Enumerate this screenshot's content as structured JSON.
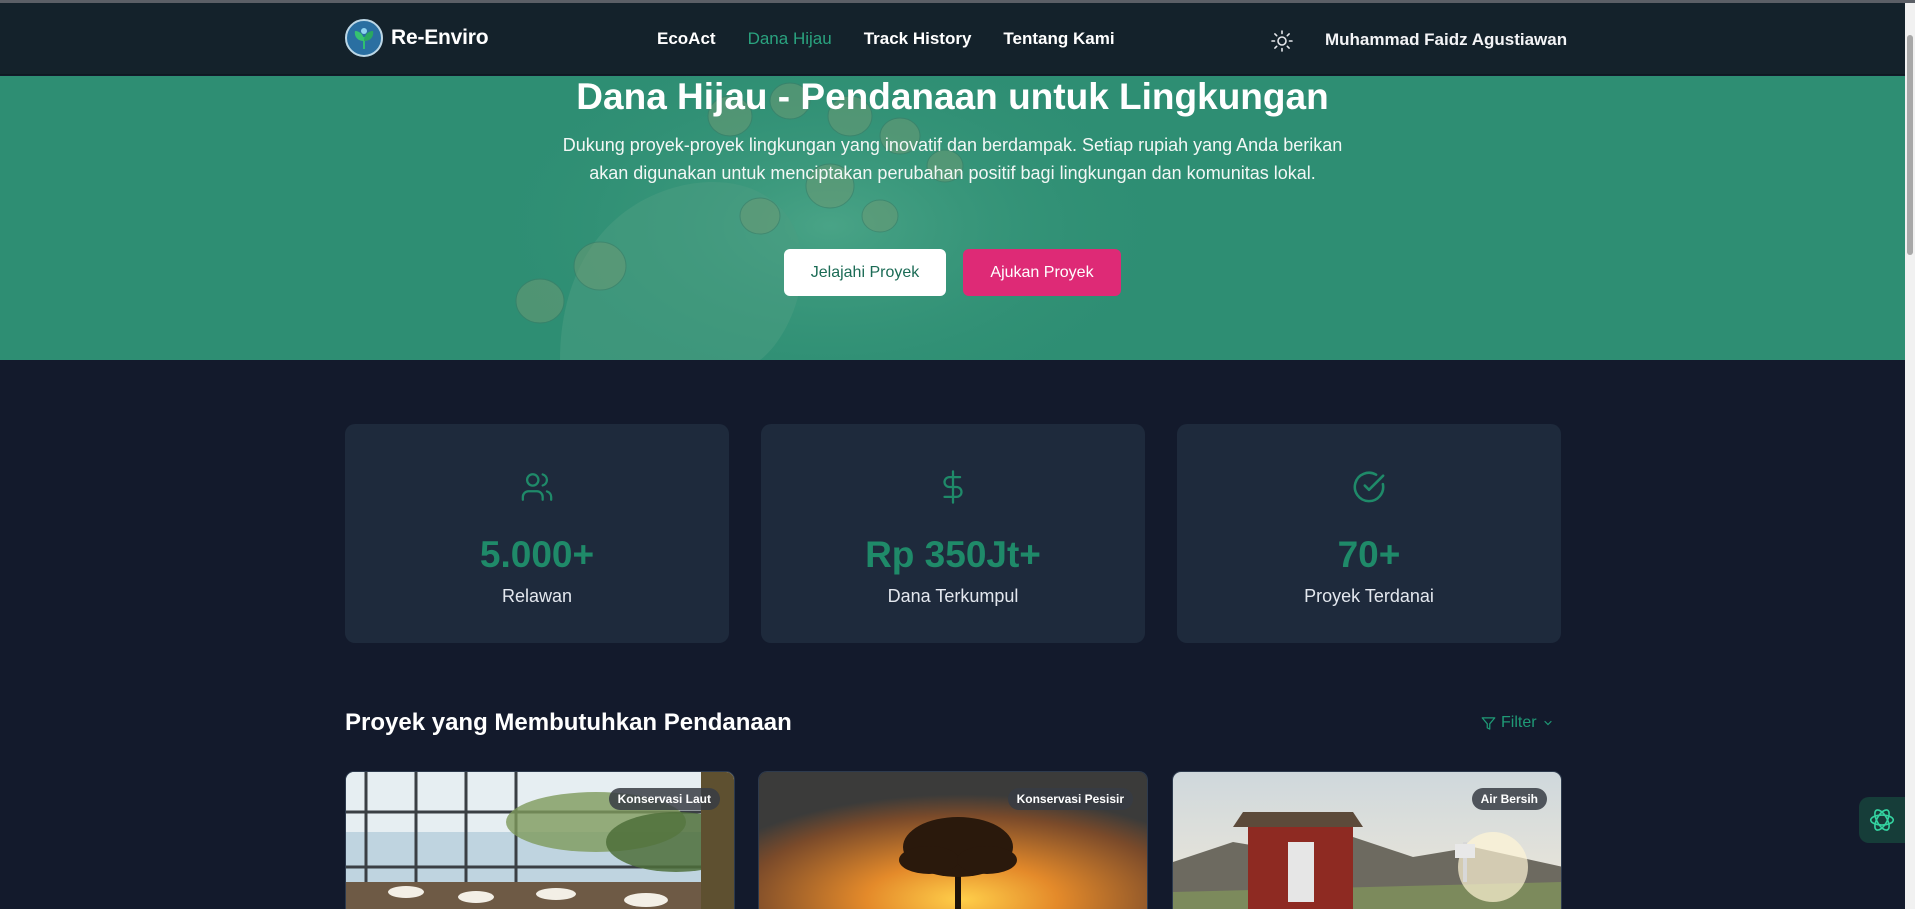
{
  "navbar": {
    "brand": "Re-Enviro",
    "links": [
      {
        "label": "EcoAct",
        "active": false
      },
      {
        "label": "Dana Hijau",
        "active": true
      },
      {
        "label": "Track History",
        "active": false
      },
      {
        "label": "Tentang Kami",
        "active": false
      }
    ],
    "theme_icon": "sun-icon",
    "user_name": "Muhammad Faidz Agustiawan"
  },
  "hero": {
    "title": "Dana Hijau - Pendanaan untuk Lingkungan",
    "description": "Dukung proyek-proyek lingkungan yang inovatif dan berdampak. Setiap rupiah yang Anda berikan akan digunakan untuk menciptakan perubahan positif bagi lingkungan dan komunitas lokal.",
    "primary_button": "Jelajahi Proyek",
    "secondary_button": "Ajukan Proyek"
  },
  "stats": [
    {
      "icon": "users-icon",
      "value": "5.000+",
      "label": "Relawan"
    },
    {
      "icon": "dollar-icon",
      "value": "Rp 350Jt+",
      "label": "Dana Terkumpul"
    },
    {
      "icon": "check-circle-icon",
      "value": "70+",
      "label": "Proyek Terdanai"
    }
  ],
  "projects_section": {
    "title": "Proyek yang Membutuhkan Pendanaan",
    "filter_label": "Filter"
  },
  "projects": [
    {
      "category": "Konservasi Laut"
    },
    {
      "category": "Konservasi Pesisir"
    },
    {
      "category": "Air Bersih"
    }
  ],
  "colors": {
    "accent": "#1f8a69",
    "hero_bg": "#2e8e73",
    "pink": "#de2a76",
    "page_bg": "#131a2c",
    "card_bg": "#1e2a3c"
  }
}
